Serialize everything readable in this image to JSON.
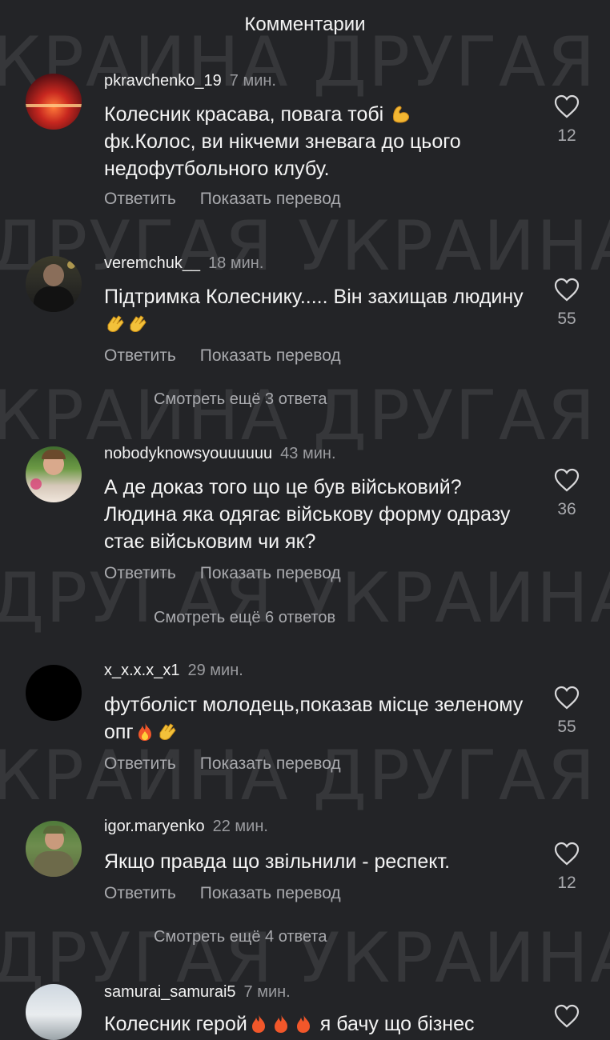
{
  "header": {
    "title": "Комментарии"
  },
  "watermark": {
    "line_a": "КРАИНА  ДРУГАЯ",
    "line_b": "ДРУГАЯ УКРАИНА"
  },
  "actions": {
    "reply": "Ответить",
    "translate": "Показать перевод"
  },
  "comments": [
    {
      "username": "pkravchenko_19",
      "time": "7 мин.",
      "text": "Колесник красава, повага тобі",
      "text_after": "фк.Колос, ви нікчеми зневага до цього недофутбольного клубу.",
      "likes": "12",
      "emoji": "flexed-biceps"
    },
    {
      "username": "veremchuk__",
      "time": "18 мин.",
      "text": "Підтримка Колеснику..... Він захищав людину",
      "likes": "55",
      "emoji": "clapping-hands"
    },
    {
      "username": "nobodyknowsyouuuuuu",
      "time": "43 мин.",
      "text": "А де доказ того що це був військовий? Людина яка одягає військову форму одразу стає військовим чи як?",
      "likes": "36"
    },
    {
      "username": "x_x.x.x_x1",
      "time": "29 мин.",
      "text": "футболіст молодець,показав місце зеленому  опг",
      "likes": "55",
      "emoji": "fire-and-clapping"
    },
    {
      "username": "igor.maryenko",
      "time": "22 мин.",
      "text": "Якщо правда що звільнили - респект.",
      "likes": "12"
    },
    {
      "username": "samurai_samurai5",
      "time": "7 мин.",
      "text": "Колесник герой",
      "text_tail": "я бачу що бізнес",
      "likes": ""
    }
  ],
  "more_replies": [
    "Смотреть ещё 3 ответа",
    "Смотреть ещё 6 ответов",
    "Смотреть ещё 4 ответа"
  ],
  "colors": {
    "background": "#232427",
    "text": "#f4f4f4",
    "muted": "#a9aaae",
    "watermark": "rgba(255,255,255,0.09)"
  }
}
